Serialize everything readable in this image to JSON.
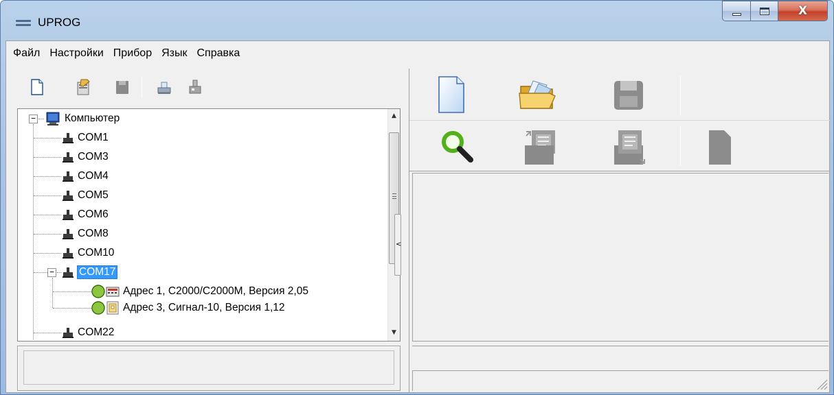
{
  "window": {
    "title": "UPROG"
  },
  "menu": [
    "Файл",
    "Настройки",
    "Прибор",
    "Язык",
    "Справка"
  ],
  "tree": {
    "root": "Компьютер",
    "ports": [
      "COM1",
      "COM3",
      "COM4",
      "COM5",
      "COM6",
      "COM8",
      "COM10"
    ],
    "selected_port": "COM17",
    "devices": [
      {
        "label": "Адрес 1, С2000/С2000М, Версия 2,05",
        "status_color": "#8dc63f",
        "icon": "control-panel-icon"
      },
      {
        "label": "Адрес 3, Сигнал-10, Версия 1,12",
        "status_color": "#8dc63f",
        "icon": "signal-device-icon"
      }
    ],
    "last_port": "COM22"
  },
  "icons": {
    "left_toolbar": [
      "new-file-icon",
      "properties-icon",
      "save-icon",
      "printer-icon",
      "port-config-icon"
    ],
    "right_row1": [
      "new-document-icon",
      "open-folder-icon",
      "save-disk-icon"
    ],
    "right_row2": [
      "search-icon",
      "read-config-icon",
      "write-config-icon",
      "blank-page-icon"
    ]
  },
  "colors": {
    "selection": "#3399ff",
    "device_ok": "#8dc63f",
    "titlebar": "#b9d1ea"
  }
}
